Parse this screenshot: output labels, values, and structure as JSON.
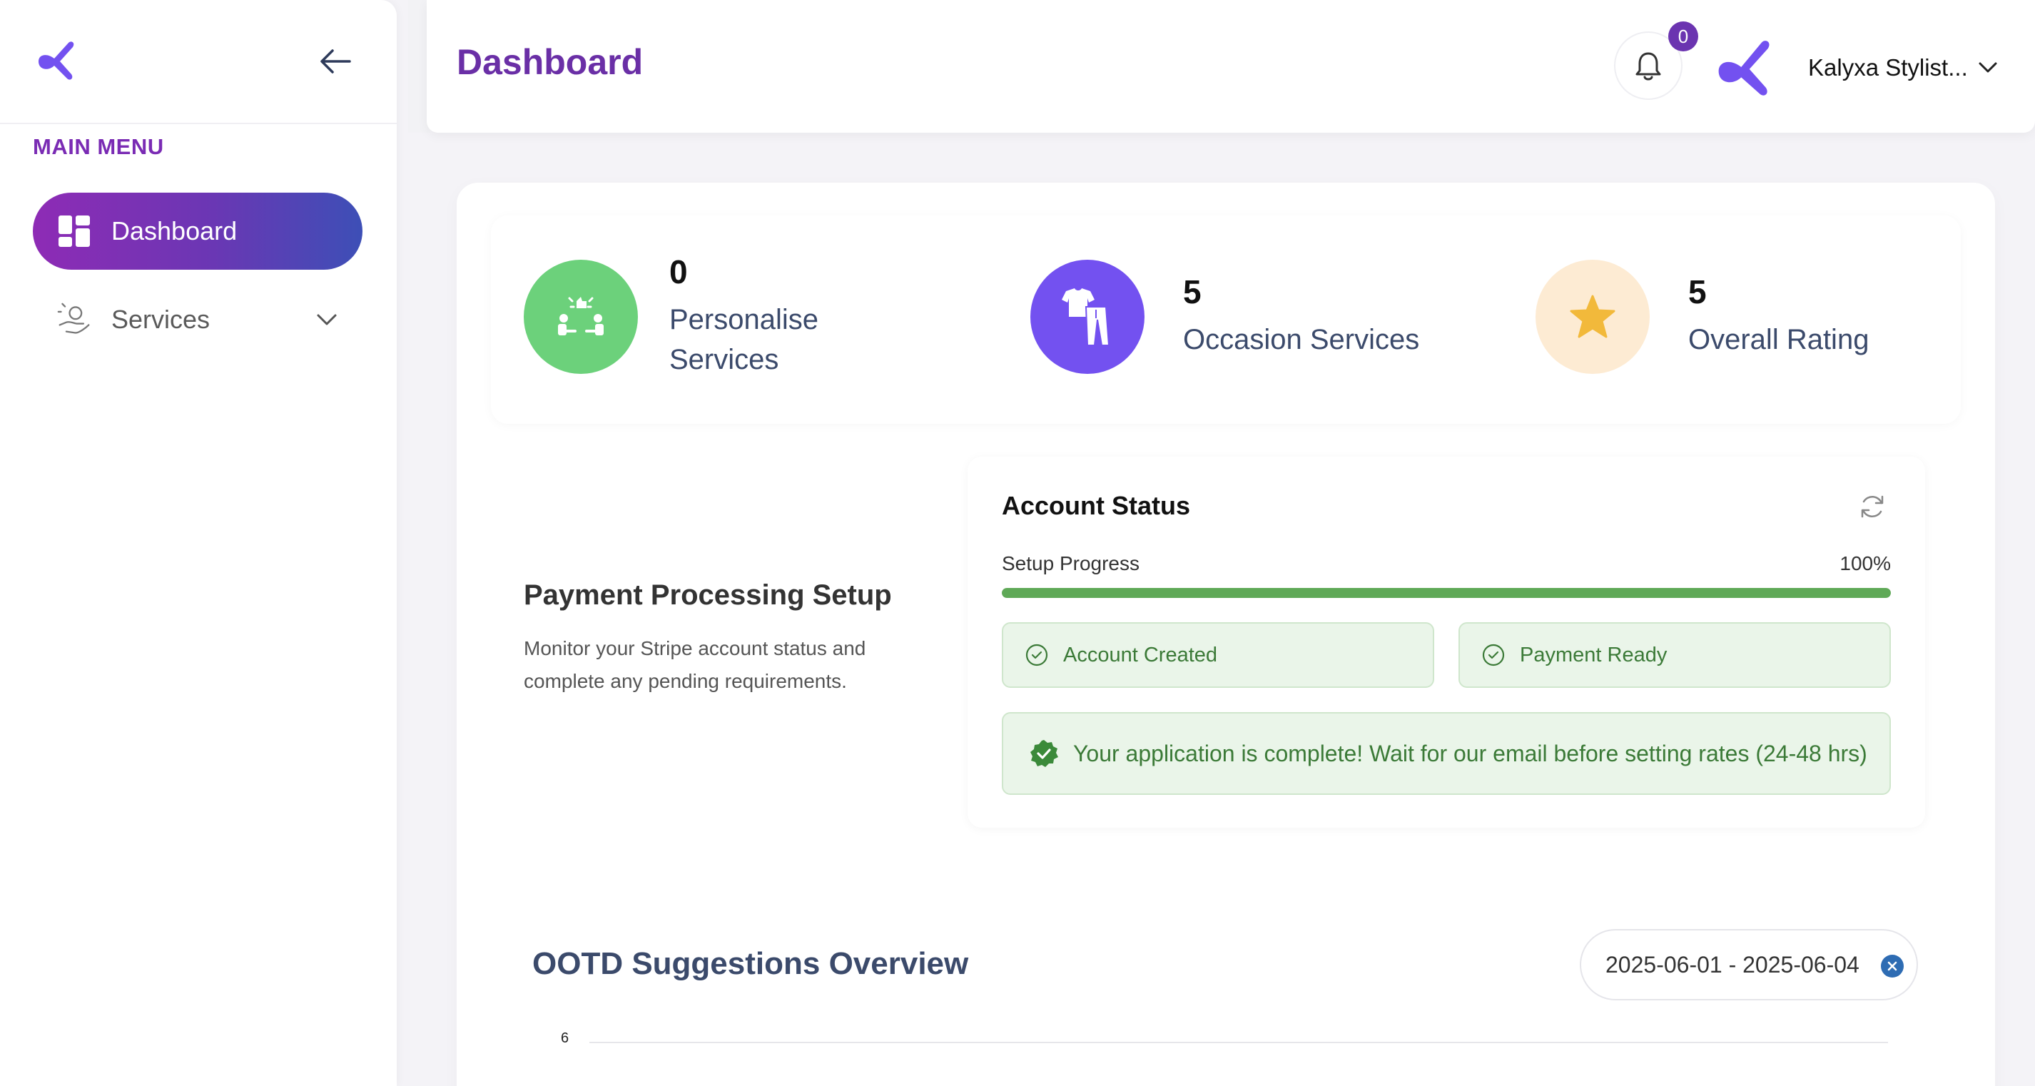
{
  "sidebar": {
    "menu_heading": "MAIN MENU",
    "items": [
      {
        "label": "Dashboard",
        "active": true,
        "icon": "dashboard-grid-icon"
      },
      {
        "label": "Services",
        "active": false,
        "icon": "service-hand-icon"
      }
    ]
  },
  "header": {
    "title": "Dashboard",
    "notifications_count": "0",
    "user_name": "Kalyxa Stylist..."
  },
  "stats": [
    {
      "value": "0",
      "label": "Personalise Services",
      "icon": "handshake-icon",
      "color": "#6cd17b"
    },
    {
      "value": "5",
      "label": "Occasion Services",
      "icon": "outfit-icon",
      "color": "#7351f0"
    },
    {
      "value": "5",
      "label": "Overall Rating",
      "icon": "star-icon",
      "color": "#fdebd3"
    }
  ],
  "payment": {
    "title": "Payment Processing Setup",
    "description": "Monitor your Stripe account status and complete any pending requirements."
  },
  "account_status": {
    "title": "Account Status",
    "progress_label": "Setup Progress",
    "progress_text": "100%",
    "progress_value": 100,
    "chips": [
      "Account Created",
      "Payment Ready"
    ],
    "notice": "Your application is complete! Wait for our email before setting rates (24-48 hrs)"
  },
  "ootd": {
    "title": "OOTD Suggestions Overview",
    "date_range": "2025-06-01 - 2025-06-04",
    "y_tick_top": "6"
  },
  "colors": {
    "brand_purple": "#6a2fa6",
    "accent_green": "#5fa957",
    "logo": "#7351f0"
  }
}
